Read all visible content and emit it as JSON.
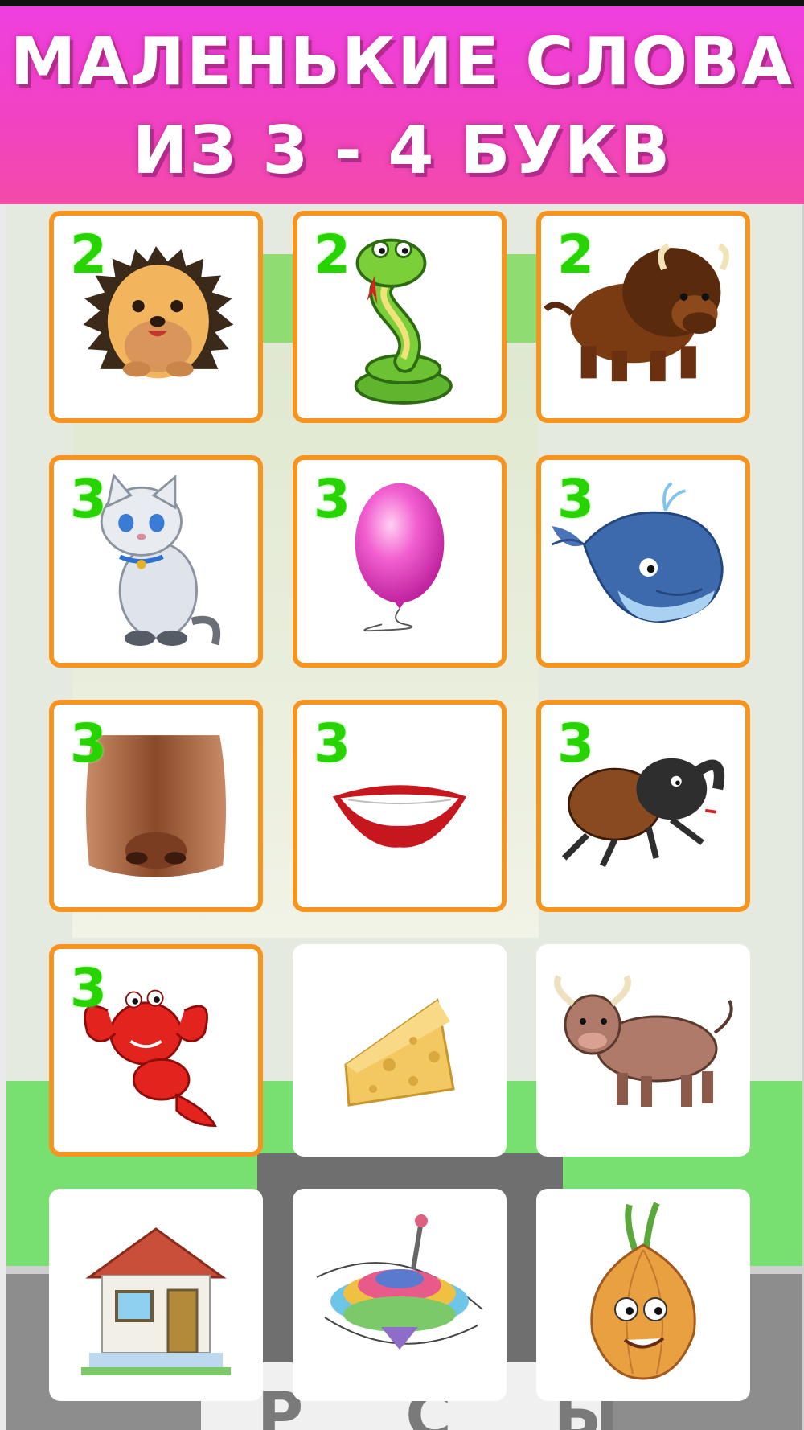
{
  "header": {
    "title_line1": "МАЛЕНЬКИЕ СЛОВА",
    "title_line2": "ИЗ 3 - 4  БУКВ"
  },
  "background": {
    "partial_word": "Р С Ы"
  },
  "cards": [
    {
      "icon": "hedgehog-icon",
      "badge": "2",
      "unlocked": true
    },
    {
      "icon": "snake-icon",
      "badge": "2",
      "unlocked": true
    },
    {
      "icon": "bison-icon",
      "badge": "2",
      "unlocked": true
    },
    {
      "icon": "cat-icon",
      "badge": "3",
      "unlocked": true
    },
    {
      "icon": "balloon-icon",
      "badge": "3",
      "unlocked": true
    },
    {
      "icon": "whale-icon",
      "badge": "3",
      "unlocked": true
    },
    {
      "icon": "nose-icon",
      "badge": "3",
      "unlocked": true
    },
    {
      "icon": "lips-icon",
      "badge": "3",
      "unlocked": true
    },
    {
      "icon": "beetle-icon",
      "badge": "3",
      "unlocked": true
    },
    {
      "icon": "crayfish-icon",
      "badge": "3",
      "unlocked": true
    },
    {
      "icon": "cheese-icon",
      "badge": "",
      "unlocked": false
    },
    {
      "icon": "bull-icon",
      "badge": "",
      "unlocked": false
    },
    {
      "icon": "house-icon",
      "badge": "",
      "unlocked": false
    },
    {
      "icon": "spinning-top-icon",
      "badge": "",
      "unlocked": false
    },
    {
      "icon": "onion-icon",
      "badge": "",
      "unlocked": false
    }
  ],
  "colors": {
    "banner_top": "#ef3fe0",
    "banner_bottom": "#f24ba8",
    "card_border": "#f7941d",
    "badge": "#27d400"
  }
}
